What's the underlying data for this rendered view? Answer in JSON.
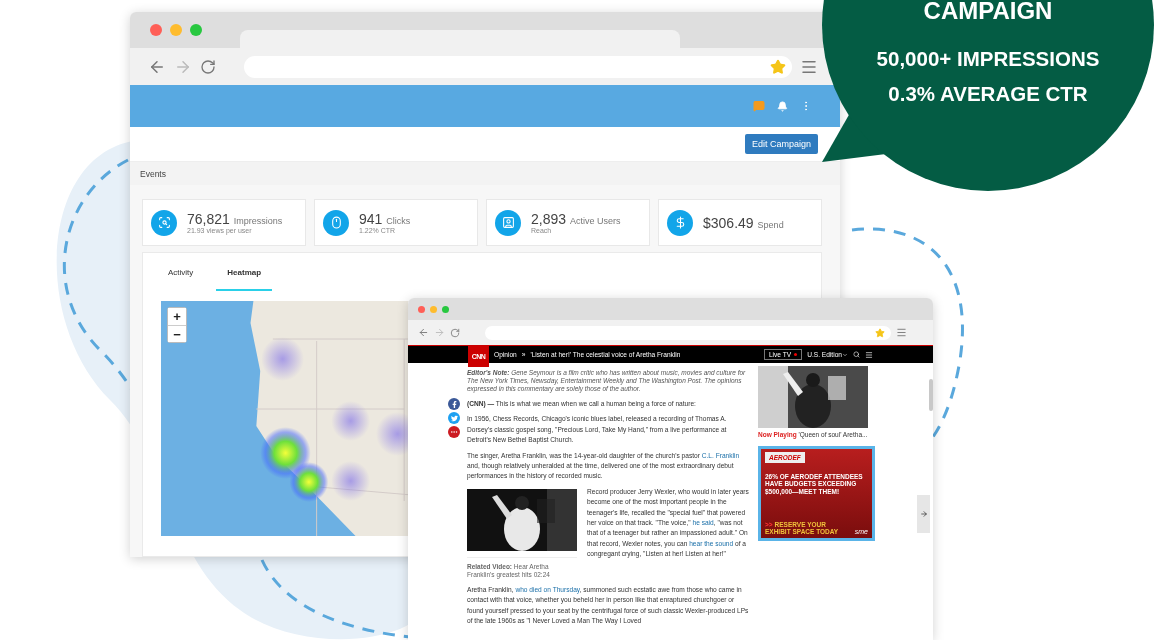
{
  "callout": {
    "title": "CAMPAIGN",
    "lines": [
      "50,000+ IMPRESSIONS",
      "0.3% AVERAGE CTR"
    ]
  },
  "dashboard": {
    "edit_button": "Edit Campaign",
    "section_title": "Events",
    "stats": [
      {
        "kind": "impressions",
        "value": "76,821",
        "label": "Impressions",
        "sub": "21.93 views per user"
      },
      {
        "kind": "clicks",
        "value": "941",
        "label": "Clicks",
        "sub": "1.22% CTR"
      },
      {
        "kind": "users",
        "value": "2,893",
        "label": "Active Users",
        "sub": "Reach"
      },
      {
        "kind": "spend",
        "value": "$306.49",
        "label": "Spend"
      }
    ],
    "tabs": [
      {
        "label": "Activity",
        "selected": false
      },
      {
        "label": "Heatmap",
        "selected": true
      }
    ],
    "map": {
      "kind": "picture",
      "zoom_in": "+",
      "zoom_out": "−"
    }
  },
  "article": {
    "logo": "CNN",
    "section": "Opinion",
    "separator": "»",
    "headline": "'Listen at her!' The celestial voice of Aretha Franklin",
    "live_tv": "Live TV",
    "edition": "U.S. Edition",
    "editors_note": "**Editor's Note:** Gene Seymour is a film critic who has written about music, movies and culture for The New York Times, Newsday, Entertainment Weekly and The Washington Post. The opinions expressed in this commentary are solely those of the author.",
    "blocks": [
      {
        "kind": "paragraph",
        "segments": [
          {
            "kind": "text",
            "text": "**(CNN) —** This is what we mean when we call a human being a force of nature:"
          }
        ]
      },
      {
        "kind": "paragraph",
        "segments": [
          {
            "kind": "text",
            "text": "In 1956, Chess Records, Chicago's iconic blues label, released a recording of Thomas A. Dorsey's classic gospel song, \"Precious Lord, Take My Hand,\" from a live performance at Detroit's New Bethel Baptist Church."
          }
        ]
      },
      {
        "kind": "paragraph",
        "segments": [
          {
            "kind": "text",
            "text": "The singer, Aretha Franklin, was the 14-year-old daughter of the church's pastor "
          },
          {
            "kind": "link",
            "text": "C.L. Franklin"
          },
          {
            "kind": "text",
            "text": " and, though relatively unheralded at the time, delivered one of the most extraordinary debut performances in the history of recorded music."
          }
        ]
      },
      {
        "kind": "media",
        "caption": "**Related Video:** Hear Aretha Franklin's greatest hits 02:24",
        "segments": [
          {
            "kind": "text",
            "text": "Record producer Jerry Wexler, who would in later years become one of the most important people in the teenager's life, recalled the \"special fuel\" that powered her voice on that track. \"The voice,\" "
          },
          {
            "kind": "link",
            "text": "he said"
          },
          {
            "kind": "text",
            "text": ", \"was not that of a teenager but rather an impassioned adult.\" On that record, Wexler notes, you can "
          },
          {
            "kind": "link",
            "text": "hear the sound"
          },
          {
            "kind": "text",
            "text": " of a congregant crying, \"Listen at her! Listen at her!\""
          }
        ]
      },
      {
        "kind": "paragraph",
        "segments": [
          {
            "kind": "text",
            "text": "Aretha Franklin, "
          },
          {
            "kind": "link",
            "text": "who died on Thursday"
          },
          {
            "kind": "text",
            "text": ", summoned such ecstatic awe from those who came in contact with that voice, whether you beheld her in person like that enraptured churchgoer or found yourself pressed to your seat by the centrifugal force of such classic Wexler-produced LPs of the late 1960s as \"I Never Loved a Man The Way I Loved"
          }
        ]
      }
    ],
    "now_playing": {
      "label": "Now Playing",
      "title": "'Queen of soul' Aretha..."
    },
    "ad": {
      "brand": "AERODEF",
      "headline": "26% OF AERODEF ATTENDEES HAVE BUDGETS EXCEEDING $500,000—MEET THEM!",
      "cta_mark": ">>",
      "cta": "RESERVE YOUR EXHIBIT SPACE TODAY",
      "sponsor": "sme"
    }
  }
}
